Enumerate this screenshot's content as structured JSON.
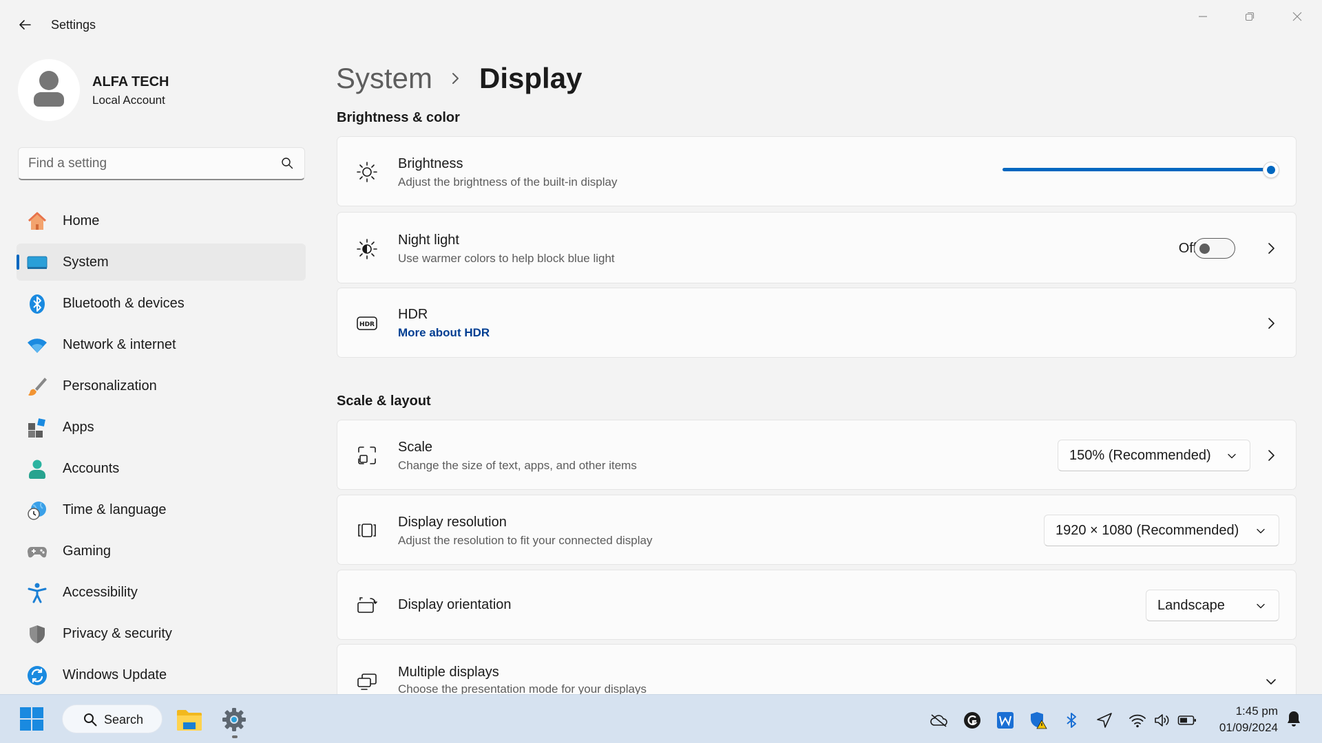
{
  "window": {
    "title": "Settings"
  },
  "profile": {
    "name": "ALFA TECH",
    "account_type": "Local Account"
  },
  "search": {
    "placeholder": "Find a setting"
  },
  "sidebar": {
    "items": [
      {
        "label": "Home",
        "icon": "home-icon"
      },
      {
        "label": "System",
        "icon": "system-icon",
        "active": true
      },
      {
        "label": "Bluetooth & devices",
        "icon": "bluetooth-icon"
      },
      {
        "label": "Network & internet",
        "icon": "wifi-icon"
      },
      {
        "label": "Personalization",
        "icon": "brush-icon"
      },
      {
        "label": "Apps",
        "icon": "apps-icon"
      },
      {
        "label": "Accounts",
        "icon": "accounts-icon"
      },
      {
        "label": "Time & language",
        "icon": "globe-clock-icon"
      },
      {
        "label": "Gaming",
        "icon": "gamepad-icon"
      },
      {
        "label": "Accessibility",
        "icon": "accessibility-icon"
      },
      {
        "label": "Privacy & security",
        "icon": "shield-icon"
      },
      {
        "label": "Windows Update",
        "icon": "update-icon"
      }
    ]
  },
  "breadcrumb": {
    "parent": "System",
    "current": "Display"
  },
  "sections": {
    "brightness_color": "Brightness & color",
    "scale_layout": "Scale & layout"
  },
  "brightness": {
    "title": "Brightness",
    "subtitle": "Adjust the brightness of the built-in display",
    "level_percent": 100
  },
  "night_light": {
    "title": "Night light",
    "subtitle": "Use warmer colors to help block blue light",
    "state": "Off"
  },
  "hdr": {
    "title": "HDR",
    "link": "More about HDR"
  },
  "scale": {
    "title": "Scale",
    "subtitle": "Change the size of text, apps, and other items",
    "value": "150% (Recommended)"
  },
  "resolution": {
    "title": "Display resolution",
    "subtitle": "Adjust the resolution to fit your connected display",
    "value": "1920 × 1080 (Recommended)"
  },
  "orientation": {
    "title": "Display orientation",
    "value": "Landscape"
  },
  "multiple_displays": {
    "title": "Multiple displays",
    "subtitle": "Choose the presentation mode for your displays"
  },
  "taskbar": {
    "search_label": "Search",
    "time": "1:45 pm",
    "date": "01/09/2024"
  },
  "colors": {
    "accent": "#0067c0",
    "link": "#003e92",
    "taskbar": "#d6e2f0"
  }
}
